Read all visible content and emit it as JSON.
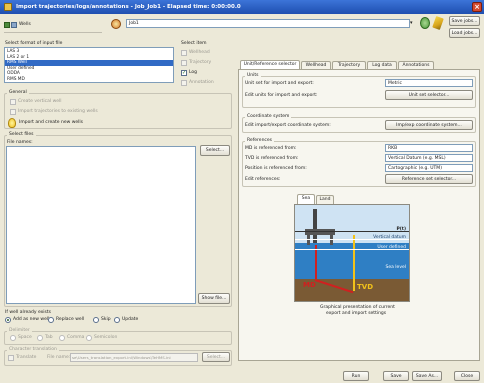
{
  "window": {
    "title": "Import trajectories/logs/annotations - Job_Job1 - Elapsed time: 0:00:00.0"
  },
  "toolbar": {
    "wells_label": "Wells",
    "source_value": "Job1",
    "save_jobs_label": "Save jobs...",
    "load_jobs_label": "Load jobs..."
  },
  "input_format": {
    "title": "Select format of input file",
    "items": [
      "LAS 3",
      "LAS 2 or 1",
      "RMS Well",
      "User defined",
      "ODDA",
      "RMS MD"
    ],
    "selected_index": 2
  },
  "select_items": {
    "title": "Select item",
    "items": [
      {
        "label": "Wellhead",
        "checked": false,
        "enabled": false
      },
      {
        "label": "Trajectory",
        "checked": false,
        "enabled": false
      },
      {
        "label": "Log",
        "checked": true,
        "enabled": true
      },
      {
        "label": "Annotation",
        "checked": false,
        "enabled": false
      }
    ]
  },
  "general": {
    "title": "General",
    "options": [
      {
        "label": "Create vertical well",
        "enabled": false
      },
      {
        "label": "Import trajectories to existing wells",
        "enabled": false
      }
    ],
    "hint": "Import and create new wells"
  },
  "select_files": {
    "title": "Select files",
    "file_names_label": "File names:",
    "select_label": "Select...",
    "show_file_label": "Show file..."
  },
  "exists": {
    "title": "If well already exists",
    "options": [
      "Add as new well",
      "Replace well",
      "Skip",
      "Update"
    ],
    "selected": 0
  },
  "delimiter": {
    "title": "Delimiter",
    "options": [
      "Space",
      "Tab",
      "Comma",
      "Semicolon"
    ]
  },
  "char_translation": {
    "title": "Character translation",
    "translate_label": "Translate",
    "file_name_label": "File name:",
    "file_name_value": "se\\Users_translation_export.ini\\Windows\\TeHMS.ini",
    "select_label": "Select..."
  },
  "tabs": [
    "Unit/Reference selector",
    "Wellhead",
    "Trajectory",
    "Log data",
    "Annotations"
  ],
  "active_tab": 0,
  "units": {
    "title": "Units",
    "row1_label": "Unit set for import and export:",
    "row1_value": "Metric",
    "row2_label": "Edit units for import and export:",
    "row2_button": "Unit set selector...",
    "coord_title": "Coordinate system",
    "row3_label": "Edit import/export coordinate system:",
    "row3_button": "Imp/exp coordinate system..."
  },
  "references": {
    "title": "References",
    "md_label": "MD is referenced from:",
    "md_value": "RKB",
    "tvd_label": "TVD is referenced from:",
    "tvd_value": "Vertical Datum (e.g. MSL)",
    "pos_label": "Position is referenced from:",
    "pos_value": "Cartographic (e.g. UTM)",
    "edit_label": "Edit references:",
    "edit_button": "Reference set selector..."
  },
  "illustration": {
    "tabs": [
      "Sea",
      "Land"
    ],
    "labels": {
      "pivot": "P(t)",
      "vertical_datum": "Vertical datum",
      "user_defined": "User defined",
      "sea_level": "Sea level",
      "md": "MD",
      "tvd": "TVD"
    },
    "caption_line1": "Graphical presentation of current",
    "caption_line2": "export and import settings",
    "colors": {
      "sky": "#cfe3f3",
      "sea": "#2f7fc4",
      "ground": "#7a5a34",
      "md": "#d02020",
      "tvd": "#f2c21a"
    }
  },
  "footer": {
    "run": "Run",
    "save": "Save",
    "save_as": "Save As...",
    "close": "Close"
  }
}
